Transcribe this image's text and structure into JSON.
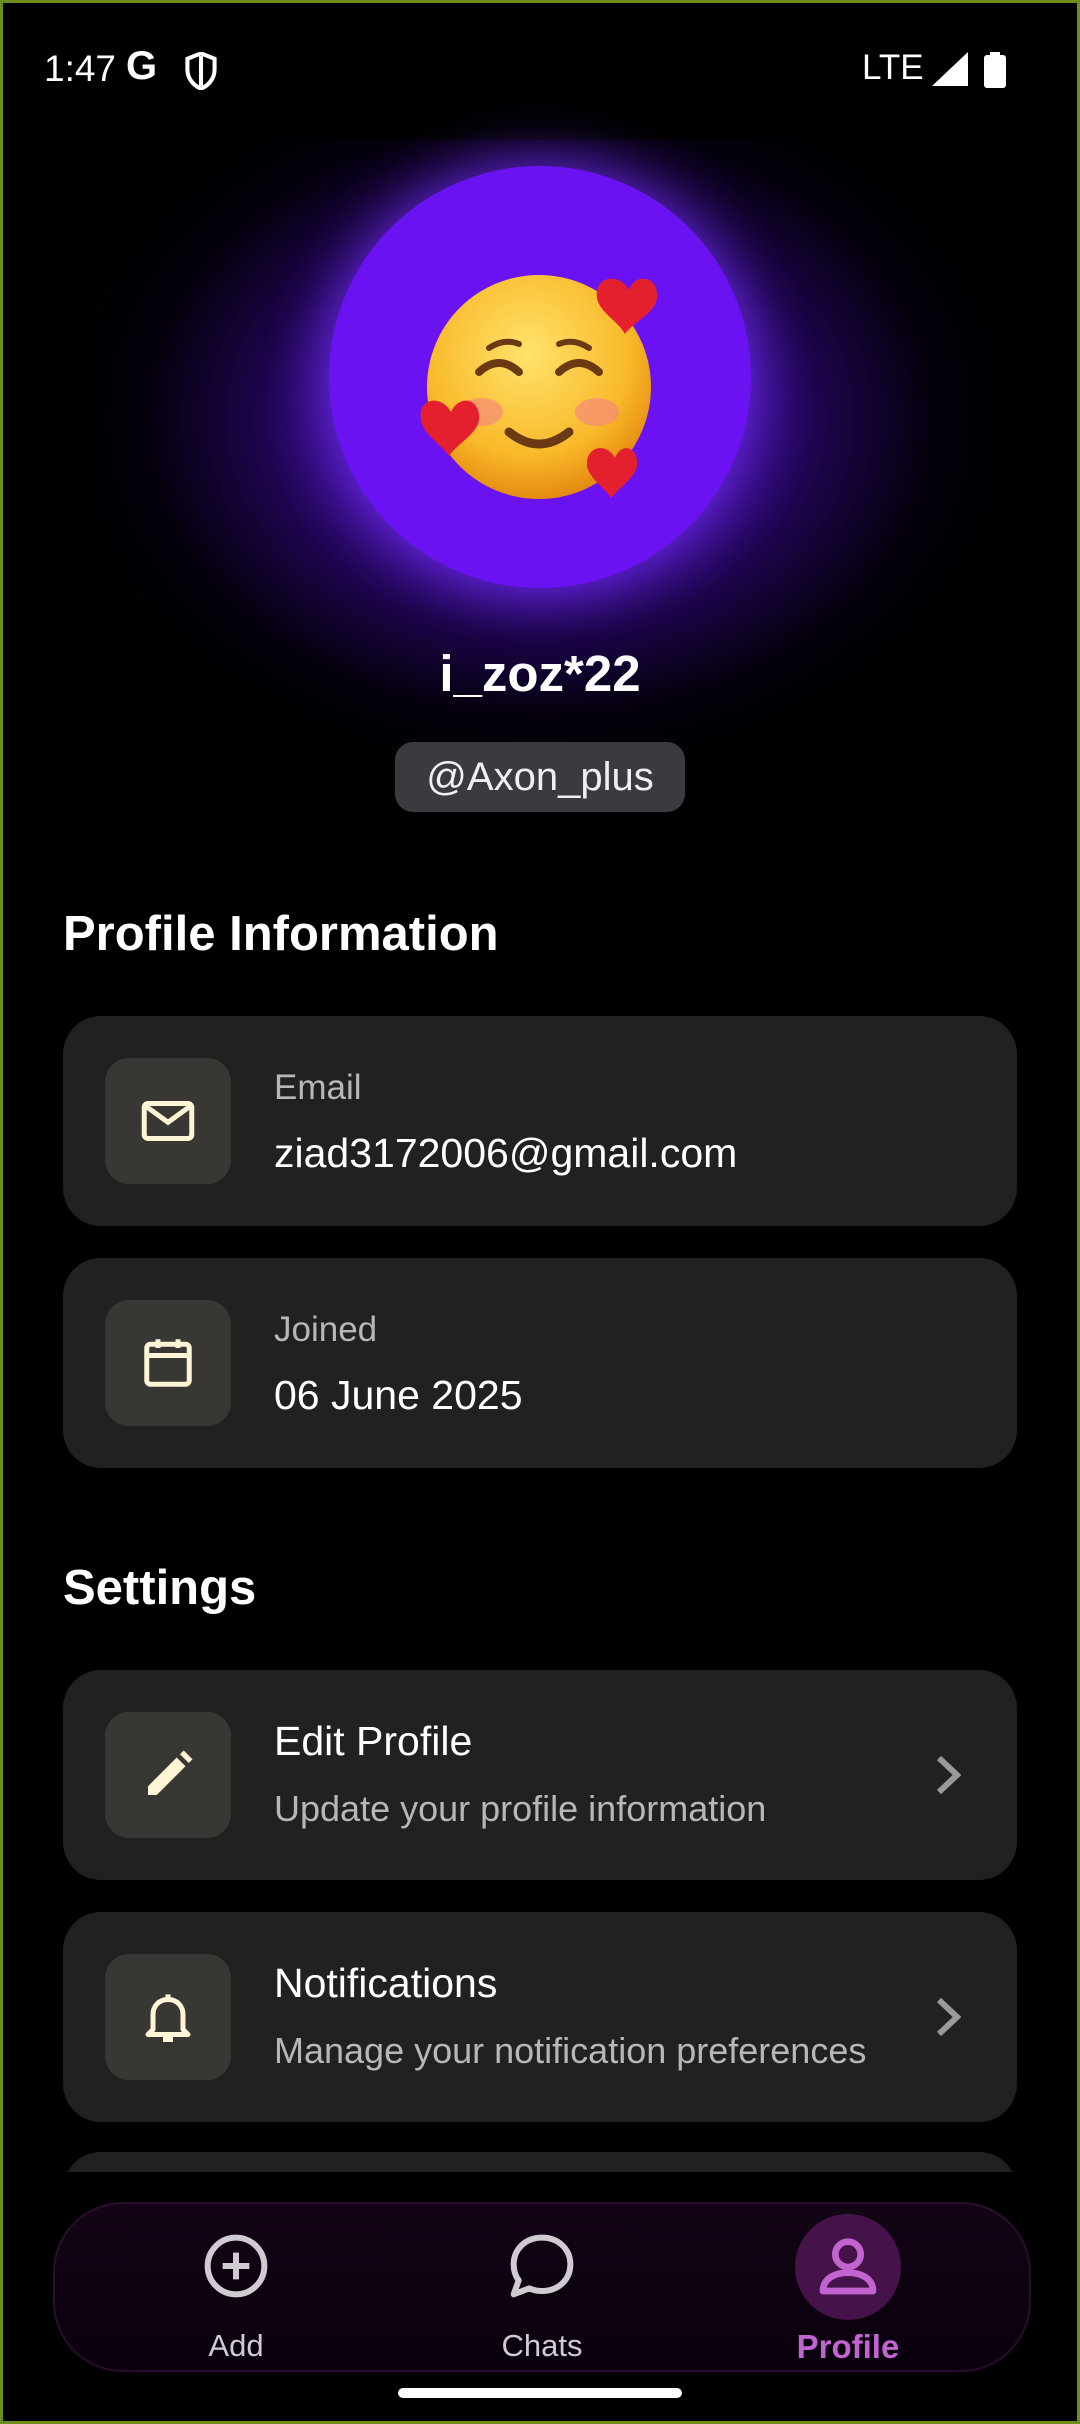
{
  "status_bar": {
    "time": "1:47",
    "carrier_glyph": "G",
    "network": "LTE",
    "icons": [
      "shield-icon",
      "signal-icon",
      "battery-icon"
    ]
  },
  "profile": {
    "display_name": "i_zoz*22",
    "handle": "@Axon_plus",
    "avatar_icon": "smiling-face-with-hearts-emoji",
    "accent": "#6b12f2"
  },
  "sections": {
    "info_title": "Profile Information",
    "settings_title": "Settings"
  },
  "info": [
    {
      "label": "Email",
      "value": "ziad3172006@gmail.com",
      "icon": "mail-icon"
    },
    {
      "label": "Joined",
      "value": "06 June 2025",
      "icon": "calendar-icon"
    }
  ],
  "settings": [
    {
      "title": "Edit Profile",
      "subtitle": "Update your profile information",
      "icon": "pencil-icon"
    },
    {
      "title": "Notifications",
      "subtitle": "Manage your notification preferences",
      "icon": "bell-icon"
    }
  ],
  "nav": {
    "items": [
      {
        "label": "Add",
        "icon": "add-circle-icon"
      },
      {
        "label": "Chats",
        "icon": "chat-bubble-icon"
      },
      {
        "label": "Profile",
        "icon": "person-icon",
        "active": true
      }
    ],
    "active_color": "#c164cf"
  }
}
